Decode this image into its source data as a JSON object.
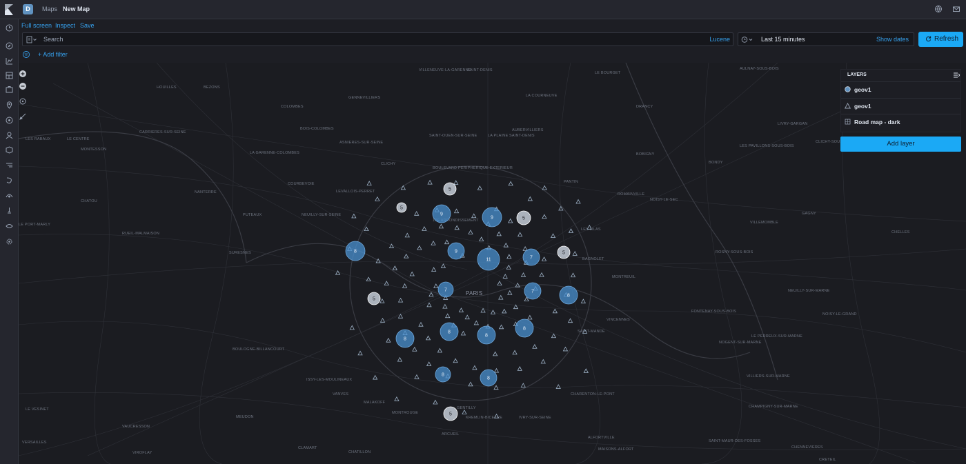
{
  "app": {
    "space_initial": "D",
    "breadcrumbs": [
      "Maps",
      "New Map"
    ]
  },
  "menu": {
    "fullscreen": "Full screen",
    "inspect": "Inspect",
    "save": "Save"
  },
  "query": {
    "placeholder": "Search",
    "language": "Lucene"
  },
  "time": {
    "range": "Last 15 minutes",
    "show_dates": "Show dates",
    "refresh": "Refresh"
  },
  "filter": {
    "add_filter": "+ Add filter"
  },
  "layers": {
    "title": "LAYERS",
    "items": [
      {
        "label": "geov1",
        "icon": "circle-layer-icon"
      },
      {
        "label": "geov1",
        "icon": "triangle-layer-icon"
      },
      {
        "label": "Road map - dark",
        "icon": "grid-layer-icon"
      }
    ],
    "add_layer": "Add layer"
  },
  "map_places": [
    "VILLENEUVE-LA-GARENNE",
    "SAINT-DENIS",
    "LE BOURGET",
    "AULNAY-SOUS-BOIS",
    "HOUILLES",
    "BEZONS",
    "GENNEVILLIERS",
    "LA COURNEUVE",
    "DRANCY",
    "COLOMBES",
    "BOIS-COLOMBES",
    "AUBERVILLIERS",
    "SAINT-OUEN-SUR-SEINE",
    "LA PLAINE SAINT-DENIS",
    "ASNIERES-SUR-SEINE",
    "LIVRY-GARGAN",
    "CARRIERES-SUR-SEINE",
    "LES RABAUX",
    "LE CENTRE",
    "MONTESSON",
    "LA GARENNE-COLOMBES",
    "BOBIGNY",
    "LES PAVILLONS-SOUS-BOIS",
    "CLICHY-SOUS-BOIS",
    "BONDY",
    "CLICHY",
    "COURBEVOIE",
    "LEVALLOIS-PERRET",
    "PANTIN",
    "NANTERRE",
    "CHATOU",
    "PUTEAUX",
    "NEUILLY-SUR-SEINE",
    "NOISY-LE-SEC",
    "ROMAINVILLE",
    "GAGNY",
    "LE PORT-MARLY",
    "RUEIL-MALMAISON",
    "LES LILAS",
    "VILLEMOMBLE",
    "CHELLES",
    "SURESNES",
    "BAGNOLET",
    "ROSNY-SOUS-BOIS",
    "MONTREUIL",
    "NEUILLY-SUR-MARNE",
    "PARIS",
    "FONTENAY-SOUS-BOIS",
    "NOISY-LE-GRAND",
    "VINCENNES",
    "SAINT-MANDE",
    "LE PERREUX-SUR-MARNE",
    "NOGENT-SUR-MARNE",
    "BOULOGNE-BILLANCOURT",
    "ISSY-LES-MOULINEAUX",
    "VANVES",
    "MALAKOFF",
    "MONTROUGE",
    "GENTILLY",
    "KREMLIN-BICETRE",
    "IVRY-SUR-SEINE",
    "CHARENTON-LE-PONT",
    "VILLIERS-SUR-MARNE",
    "CHAMPIGNY-SUR-MARNE",
    "MEUDON",
    "ARCUEIL",
    "ALFORTVILLE",
    "CLAMART",
    "VERSAILLES",
    "VIROFLAY",
    "CHATILLON",
    "MAISONS-ALFORT",
    "SAINT-MAUR-DES-FOSSES",
    "CRETEIL",
    "CHENNEVIERES",
    "BOUGIVAL",
    "LE VESINET",
    "VAUCRESSON",
    "17E ARRONDISSEMENT",
    "BOULEVARD PERIPHERIQUE EXTERIEUR"
  ],
  "clusters": [
    {
      "count": "8"
    },
    {
      "count": "9"
    },
    {
      "count": "9"
    },
    {
      "count": "9"
    },
    {
      "count": "11"
    },
    {
      "count": "7"
    },
    {
      "count": "7"
    },
    {
      "count": "7"
    },
    {
      "count": "8"
    },
    {
      "count": "8"
    },
    {
      "count": "8"
    },
    {
      "count": "8"
    },
    {
      "count": "8"
    },
    {
      "count": "8"
    },
    {
      "count": "8"
    },
    {
      "count": "5"
    },
    {
      "count": "5"
    },
    {
      "count": "5"
    },
    {
      "count": "5"
    },
    {
      "count": "5"
    },
    {
      "count": "5"
    }
  ],
  "colors": {
    "accent": "#1ba9f5",
    "link": "#36a2ef",
    "cluster_blue": "#4a90d0",
    "cluster_light": "#d0d8e4"
  }
}
